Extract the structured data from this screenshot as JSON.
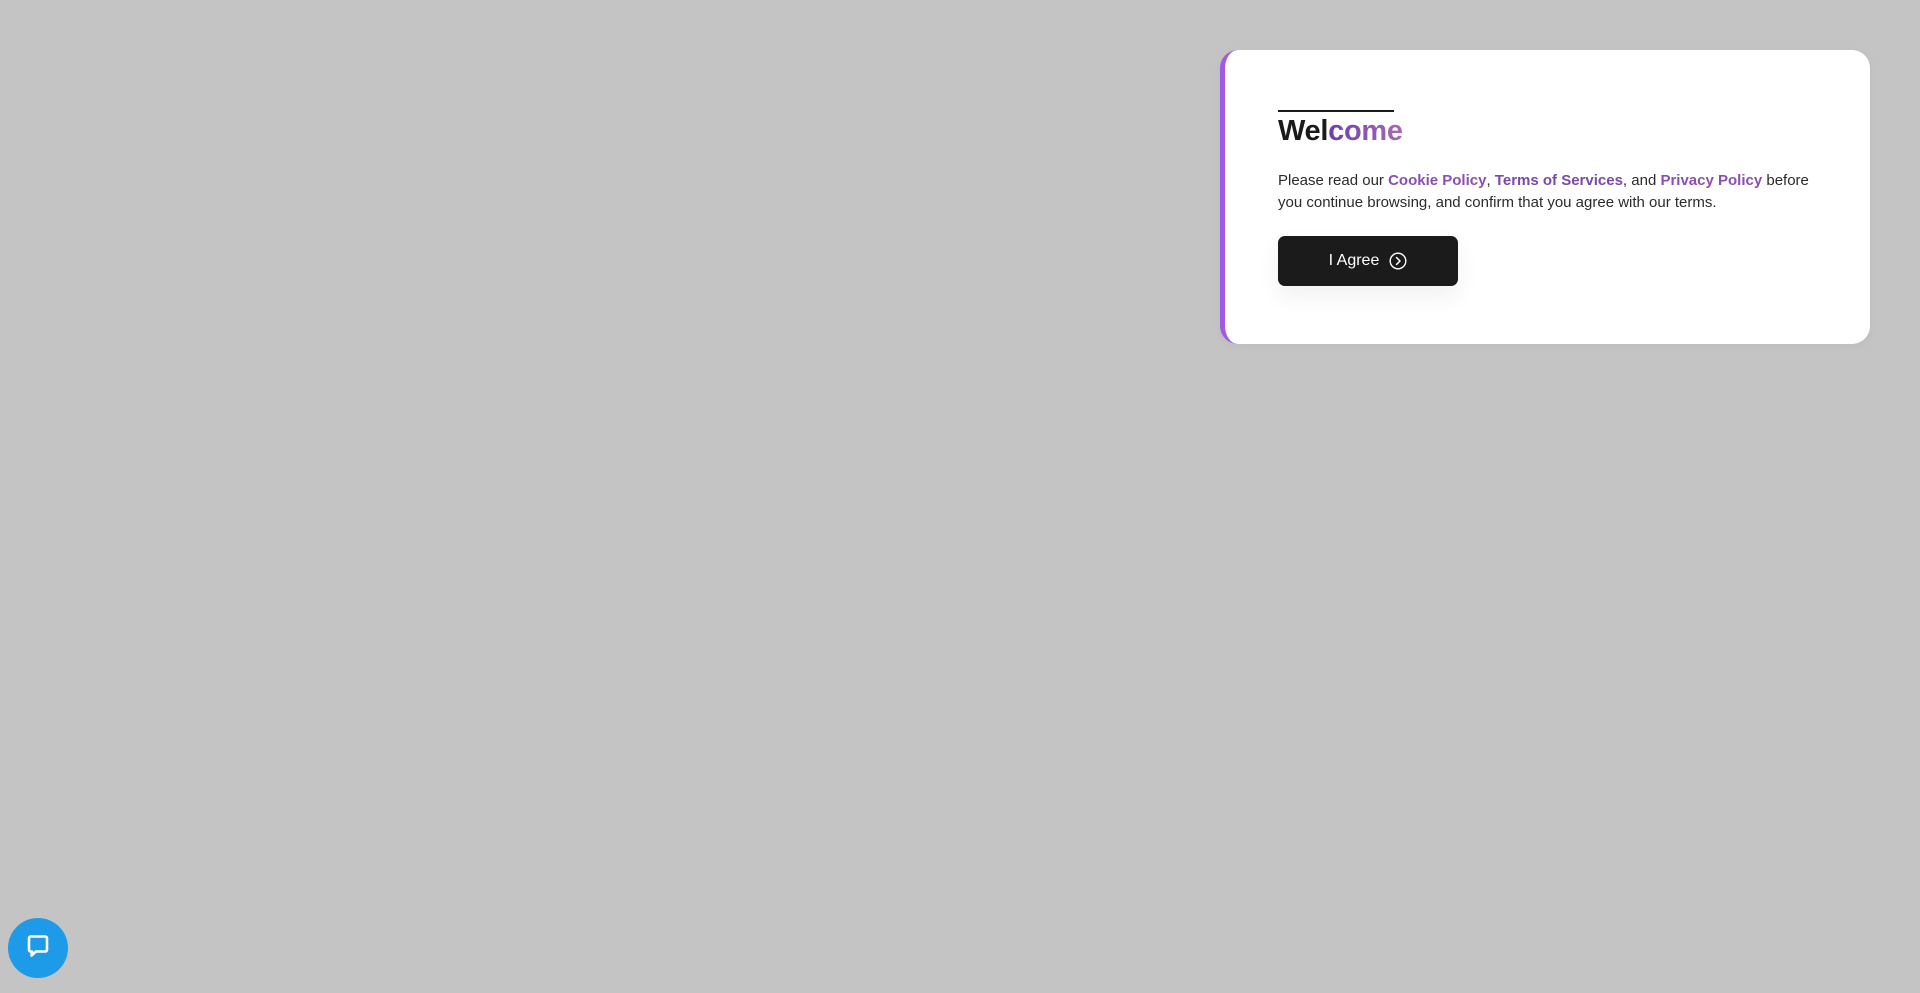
{
  "consent_modal": {
    "title_part1": "Wel",
    "title_part2": "come",
    "text_before": "Please read our ",
    "cookie_link": "Cookie Policy",
    "sep1": ", ",
    "terms_link": "Terms of Services",
    "sep2": ", and ",
    "privacy_link": "Privacy Policy",
    "text_after": " before you continue browsing, and confirm that you agree with our terms.",
    "agree_label": "I Agree",
    "agree_icon": "chevron-right-circle-icon",
    "accent_color": "#a259e8"
  },
  "chat_widget": {
    "icon": "chat-bubble-icon",
    "color": "#1e9be8"
  }
}
